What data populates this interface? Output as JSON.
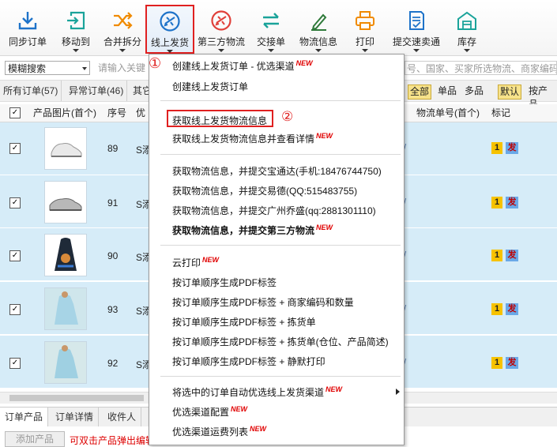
{
  "toolbar": [
    {
      "label": "同步订单",
      "icon": "download-icon",
      "color": "#1e73c9"
    },
    {
      "label": "移动到",
      "icon": "move-icon",
      "color": "#1aa39a"
    },
    {
      "label": "合并拆分",
      "icon": "shuffle-icon",
      "color": "#f08a00"
    },
    {
      "label": "线上发货",
      "icon": "airplane-circle-icon",
      "color": "#1e73c9"
    },
    {
      "label": "第三方物流",
      "icon": "airplane-circle-red-icon",
      "color": "#e0403a"
    },
    {
      "label": "交接单",
      "icon": "exchange-icon",
      "color": "#1aa39a"
    },
    {
      "label": "物流信息",
      "icon": "pen-icon",
      "color": "#2f7a3a"
    },
    {
      "label": "打印",
      "icon": "printer-icon",
      "color": "#f08a00"
    },
    {
      "label": "提交速卖通",
      "icon": "document-check-icon",
      "color": "#1e73c9"
    },
    {
      "label": "库存",
      "icon": "warehouse-icon",
      "color": "#1aa39a"
    }
  ],
  "filter": {
    "select_value": "模糊搜索",
    "search_placeholder": "请输入关键",
    "search_right": "号、国家、买家所选物流、商家编码..."
  },
  "tabs": [
    "所有订单(57)",
    "异常订单(46)",
    "其它"
  ],
  "pills": {
    "all": "全部",
    "single": "单品",
    "multi": "多品",
    "default": "默认",
    "by_product": "按产品"
  },
  "table": {
    "headers": {
      "image": "产品图片(首个)",
      "seq": "序号",
      "priority": "优",
      "tracking": "物流单号(首个)",
      "mark": "标记"
    },
    "rows": [
      {
        "seq": "89",
        "sku_prefix": "S添",
        "mark1": "1",
        "mark2": "发"
      },
      {
        "seq": "91",
        "sku_prefix": "S添",
        "mark1": "1",
        "mark2": "发"
      },
      {
        "seq": "90",
        "sku_prefix": "S添",
        "mark1": "1",
        "mark2": "发"
      },
      {
        "seq": "93",
        "sku_prefix": "S添",
        "mark1": "1",
        "mark2": "发"
      },
      {
        "seq": "92",
        "sku_prefix": "S添",
        "mark1": "1",
        "mark2": "发"
      }
    ]
  },
  "bottom_tabs": [
    "订单产品",
    "订单详情",
    "收件人"
  ],
  "bottom": {
    "add_button": "添加产品",
    "hint": "可双击产品弹出编辑"
  },
  "menu": {
    "items": [
      {
        "label": "创建线上发货订单 - 优选渠道",
        "new": "NEW",
        "bold": false
      },
      {
        "label": "创建线上发货订单",
        "new": "",
        "bold": false
      },
      {
        "label": "获取线上发货物流信息",
        "new": "",
        "bold": false
      },
      {
        "label": "获取线上发货物流信息并查看详情",
        "new": "NEW",
        "bold": false
      },
      {
        "label": "获取物流信息，并提交宝通达(手机:18476744750)",
        "new": "",
        "bold": false
      },
      {
        "label": "获取物流信息，并提交易德(QQ:515483755)",
        "new": "",
        "bold": false
      },
      {
        "label": "获取物流信息，并提交广州乔盛(qq:2881301110)",
        "new": "",
        "bold": false
      },
      {
        "label": "获取物流信息，并提交第三方物流",
        "new": "NEW",
        "bold": true
      },
      {
        "label": "云打印",
        "new": "NEW",
        "bold": false
      },
      {
        "label": "按订单顺序生成PDF标签",
        "new": "",
        "bold": false
      },
      {
        "label": "按订单顺序生成PDF标签 + 商家编码和数量",
        "new": "",
        "bold": false
      },
      {
        "label": "按订单顺序生成PDF标签 + 拣货单",
        "new": "",
        "bold": false
      },
      {
        "label": "按订单顺序生成PDF标签 + 拣货单(仓位、产品简述)",
        "new": "",
        "bold": false
      },
      {
        "label": "按订单顺序生成PDF标签 + 静默打印",
        "new": "",
        "bold": false
      },
      {
        "label": "将选中的订单自动优选线上发货渠道",
        "new": "NEW",
        "bold": false
      },
      {
        "label": "优选渠道配置",
        "new": "NEW",
        "bold": false
      },
      {
        "label": "优选渠道运费列表",
        "new": "NEW",
        "bold": false
      }
    ]
  },
  "annotations": {
    "one": "①",
    "two": "②"
  },
  "highlight_color": "#e02020"
}
